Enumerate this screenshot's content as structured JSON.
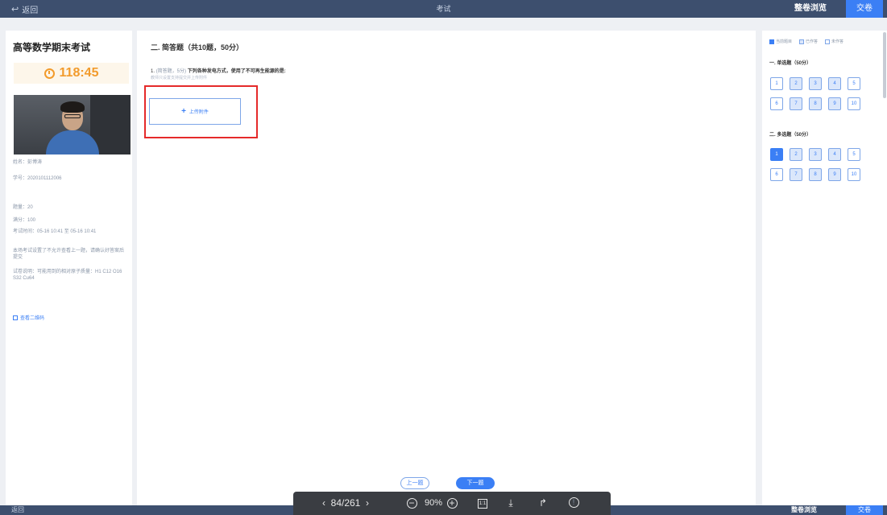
{
  "header": {
    "back_label": "返回",
    "title": "考试",
    "preview_label": "整卷浏览",
    "submit_label": "交卷"
  },
  "left_panel": {
    "exam_title": "高等数学期末考试",
    "timer": "118:45",
    "candidate_name": "姓名：彭博涛",
    "candidate_id": "学号：2020101112006",
    "question_count": "题量：20",
    "total_score": "满分：100",
    "exam_time": "考试时间：05-16 10:41 至 05-16 10:41",
    "notice": "本场考试设置了不允许查看上一题，请确认好答案后提交",
    "instructions": "试卷说明：可能用到的相对原子质量：H1 C12 O16 S32 Cu64",
    "qr_link": "查看二维码"
  },
  "main": {
    "section_title": "二. 简答题（共10题，50分）",
    "question_number": "1.",
    "question_tag": "(简答题，5分)",
    "question_text": "下列各种发电方式，使用了不可再生能源的是:",
    "question_hint": "教师只设置支持提交并上传附件",
    "upload_label": "上传附件",
    "prev_label": "上一题",
    "next_label": "下一题"
  },
  "right_panel": {
    "legend": [
      "当前题目",
      "已作答",
      "未作答"
    ],
    "group1_title": "一. 单选题（50分）",
    "group2_title": "二. 多选题（50分）",
    "group1_cells": [
      "1",
      "2",
      "3",
      "4",
      "5",
      "6",
      "7",
      "8",
      "9",
      "10"
    ],
    "group2_cells": [
      "1",
      "2",
      "3",
      "4",
      "5",
      "6",
      "7",
      "8",
      "9",
      "10"
    ]
  },
  "viewer": {
    "page": "84/261",
    "zoom": "90%",
    "fit": "1:1"
  },
  "colors": {
    "accent": "#3b7ff5",
    "header_bg": "#3d4f6e",
    "timer": "#f29b2c",
    "highlight": "#e52a2a"
  }
}
